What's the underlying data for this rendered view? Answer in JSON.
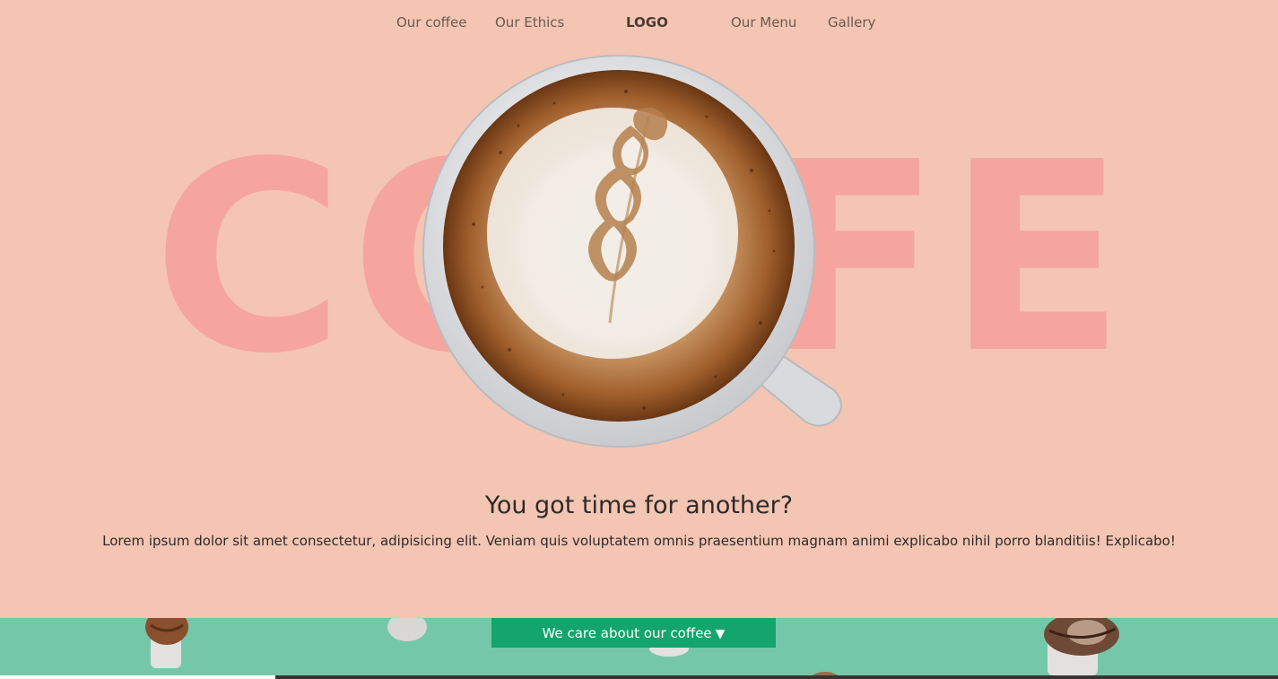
{
  "nav": {
    "items": [
      {
        "label": "Our coffee"
      },
      {
        "label": "Our Ethics"
      },
      {
        "label": "LOGO"
      },
      {
        "label": "Our Menu"
      },
      {
        "label": "Gallery"
      }
    ]
  },
  "hero": {
    "background_word": "COFFEE",
    "headline": "You got time for another?",
    "body": "Lorem ipsum dolor sit amet consectetur, adipisicing elit. Veniam quis voluptatem omnis praesentium magnam animi explicabo nihil porro blanditiis! Explicabo!"
  },
  "band": {
    "cta_label": "We care about our coffee",
    "cta_icon": "▼"
  },
  "colors": {
    "page_bg": "#f4c5b2",
    "big_word": "#f6a59e",
    "band_bg": "#74c8a9",
    "cta_bg": "#14a46d"
  }
}
